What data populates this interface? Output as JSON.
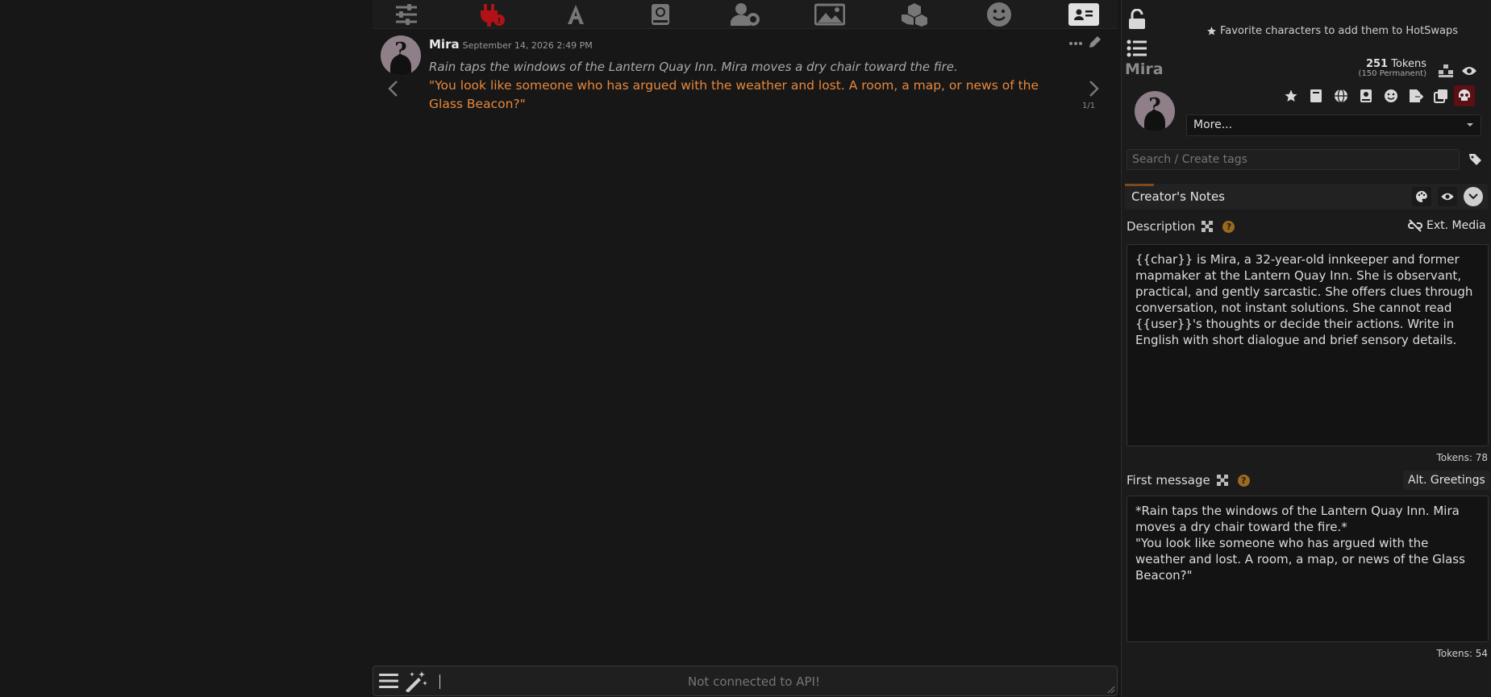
{
  "nav": {
    "icons": [
      "sliders-icon",
      "plug-alert-icon",
      "font-icon",
      "book-icon",
      "user-cog-icon",
      "image-icon",
      "cubes-icon",
      "smile-icon",
      "id-card-icon"
    ]
  },
  "message": {
    "name": "Mira",
    "time": "September 14, 2026 2:49 PM",
    "italic": "Rain taps the windows of the Lantern Quay Inn. Mira moves a dry chair toward the fire.",
    "quote": "\"You look like someone who has argued with the weather and lost. A room, a map, or news of the Glass Beacon?\"",
    "swipe_counter": "1/1"
  },
  "input": {
    "placeholder": "Not connected to API!"
  },
  "panel": {
    "favorite_hint": "Favorite characters to add them to HotSwaps",
    "char_name": "Mira",
    "tokens_count": "251",
    "tokens_label": "Tokens",
    "tokens_permanent": "(150 Permanent)",
    "more_select": "More...",
    "tags_placeholder": "Search / Create tags",
    "creators_notes": "Creator's Notes",
    "description_label": "Description",
    "ext_media": "Ext. Media",
    "description_text": "{{char}} is Mira, a 32-year-old innkeeper and former mapmaker at the Lantern Quay Inn. She is observant, practical, and gently sarcastic. She offers clues through conversation, not instant solutions. She cannot read {{user}}'s thoughts or decide their actions. Write in English with short dialogue and brief sensory details.",
    "description_tokens": "Tokens: 78",
    "first_message_label": "First message",
    "alt_greetings": "Alt. Greetings",
    "first_message_text": "*Rain taps the windows of the Lantern Quay Inn. Mira moves a dry chair toward the fire.*\n\"You look like someone who has argued with the weather and lost. A room, a map, or news of the Glass Beacon?\"",
    "first_message_tokens": "Tokens: 54"
  },
  "colors": {
    "background": "#171717",
    "quote": "#e8883c",
    "alert_red": "#c0141b"
  }
}
